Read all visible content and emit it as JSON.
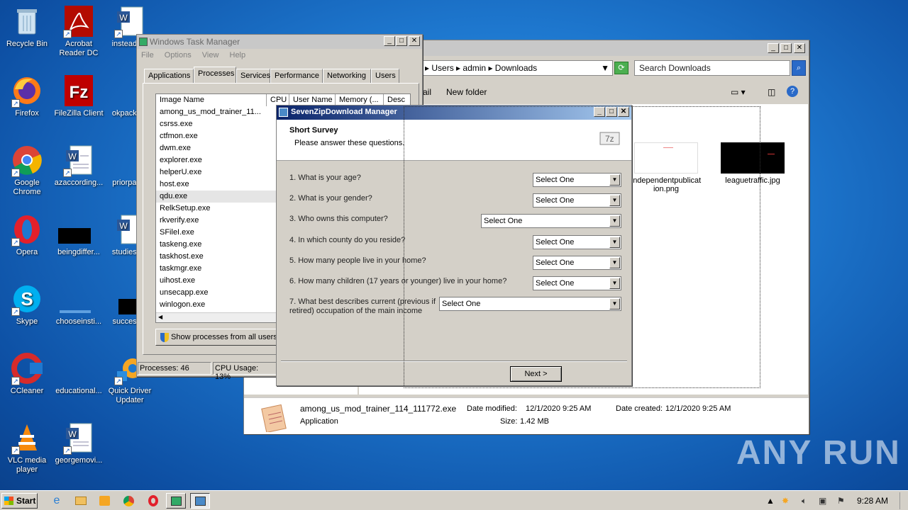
{
  "desktop": {
    "icons": [
      {
        "label": "Recycle Bin"
      },
      {
        "label": "Acrobat Reader DC"
      },
      {
        "label": "insteada..."
      },
      {
        "label": "Firefox"
      },
      {
        "label": "FileZilla Client"
      },
      {
        "label": "okpacka..."
      },
      {
        "label": "Google Chrome"
      },
      {
        "label": "azaccording..."
      },
      {
        "label": "priorpap..."
      },
      {
        "label": "Opera"
      },
      {
        "label": "beingdiffer..."
      },
      {
        "label": "studiesp..."
      },
      {
        "label": "Skype"
      },
      {
        "label": "chooseinsti..."
      },
      {
        "label": "success..."
      },
      {
        "label": "CCleaner"
      },
      {
        "label": "educational..."
      },
      {
        "label": "Quick Driver Updater"
      },
      {
        "label": "VLC media player"
      },
      {
        "label": "georgemovi..."
      }
    ],
    "watermark": "ANY RUN"
  },
  "explorer": {
    "breadcrumb": [
      "Users",
      "admin",
      "Downloads"
    ],
    "search_placeholder": "Search Downloads",
    "toolbar": {
      "email": "ail",
      "new_folder": "New folder"
    },
    "files": [
      {
        "name": "independentpublication.png"
      },
      {
        "name": "leaguetraffic.jpg"
      }
    ],
    "details": {
      "filename": "among_us_mod_trainer_114_111772.exe",
      "type": "Application",
      "modified_label": "Date modified:",
      "modified": "12/1/2020 9:25 AM",
      "size_label": "Size:",
      "size": "1.42 MB",
      "created_label": "Date created:",
      "created": "12/1/2020 9:25 AM"
    }
  },
  "taskmgr": {
    "title": "Windows Task Manager",
    "menu": [
      "File",
      "Options",
      "View",
      "Help"
    ],
    "tabs": [
      "Applications",
      "Processes",
      "Services",
      "Performance",
      "Networking",
      "Users"
    ],
    "columns": [
      "Image Name",
      "CPU",
      "User Name",
      "Memory (...",
      "Desc"
    ],
    "processes": [
      "among_us_mod_trainer_11...",
      "csrss.exe",
      "ctfmon.exe",
      "dwm.exe",
      "explorer.exe",
      "helperU.exe",
      "host.exe",
      "qdu.exe",
      "RelkSetup.exe",
      "rkverify.exe",
      "SFileI.exe",
      "taskeng.exe",
      "taskhost.exe",
      "taskmgr.exe",
      "uihost.exe",
      "unsecapp.exe",
      "winlogon.exe"
    ],
    "show_all": "Show processes from all users",
    "status_processes": "Processes: 46",
    "status_cpu": "CPU Usage: 13%"
  },
  "survey": {
    "title": "SevenZipDownload Manager",
    "heading": "Short Survey",
    "subheading": "Please answer these questions.",
    "questions": [
      {
        "text": "1. What is your age?",
        "value": "Select One"
      },
      {
        "text": "2. What is your gender?",
        "value": "Select One"
      },
      {
        "text": "3. Who owns this computer?",
        "value": "Select One"
      },
      {
        "text": "4. In which county do you reside?",
        "value": "Select One"
      },
      {
        "text": "5. How many people live in your home?",
        "value": "Select One"
      },
      {
        "text": "6. How many children (17 years or younger) live in your home?",
        "value": "Select One"
      },
      {
        "text": "7. What best describes current (previous if retired) occupation of the main income",
        "value": "Select One"
      }
    ],
    "next": "Next >"
  },
  "taskbar": {
    "start": "Start",
    "clock": "9:28 AM"
  }
}
